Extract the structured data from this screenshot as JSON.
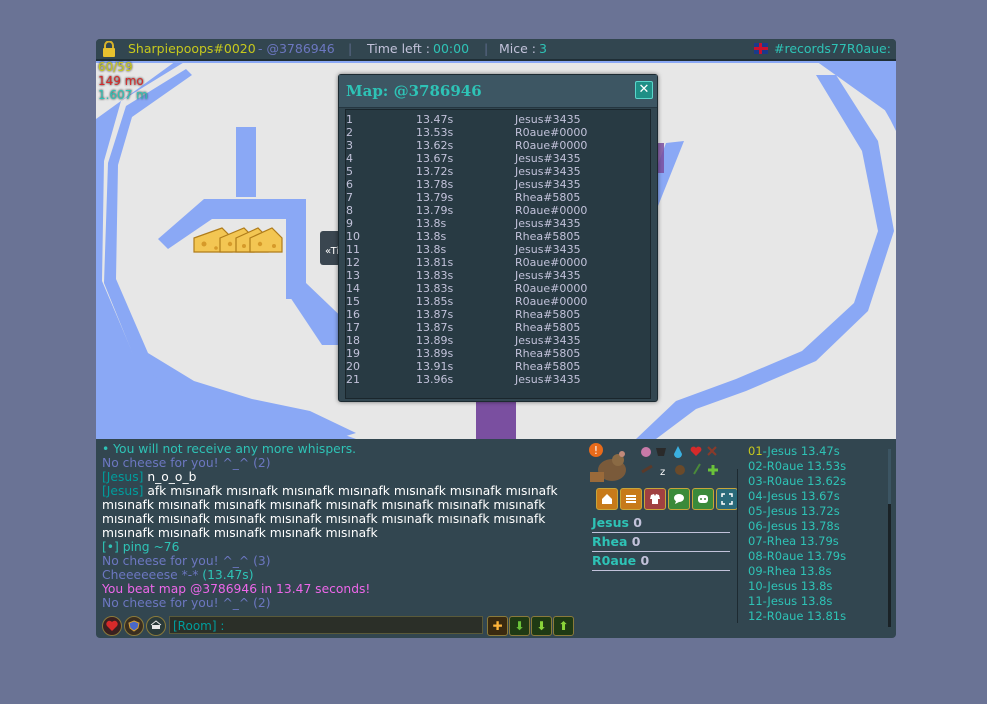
{
  "topbar": {
    "player": "Sharpiepoops#0020",
    "map_code": " - @3786946",
    "time_label": "Time left : ",
    "time_value": "00:00",
    "mice_label": "Mice : ",
    "mice_value": "3",
    "room": "#records77R0aue:",
    "sep1": "|",
    "sep2": "|"
  },
  "stats": {
    "fps": "60/59",
    "mo": "149 mo",
    "m": "1.607 m"
  },
  "map_sign": "«Ti",
  "popup": {
    "title": "Map: @3786946",
    "close_label": "✕",
    "records": [
      {
        "rank": "1",
        "time": "13.47s",
        "player": "Jesus#3435"
      },
      {
        "rank": "2",
        "time": "13.53s",
        "player": "R0aue#0000"
      },
      {
        "rank": "3",
        "time": "13.62s",
        "player": "R0aue#0000"
      },
      {
        "rank": "4",
        "time": "13.67s",
        "player": "Jesus#3435"
      },
      {
        "rank": "5",
        "time": "13.72s",
        "player": "Jesus#3435"
      },
      {
        "rank": "6",
        "time": "13.78s",
        "player": "Jesus#3435"
      },
      {
        "rank": "7",
        "time": "13.79s",
        "player": "Rhea#5805"
      },
      {
        "rank": "8",
        "time": "13.79s",
        "player": "R0aue#0000"
      },
      {
        "rank": "9",
        "time": "13.8s",
        "player": "Jesus#3435"
      },
      {
        "rank": "10",
        "time": "13.8s",
        "player": "Rhea#5805"
      },
      {
        "rank": "11",
        "time": "13.8s",
        "player": "Jesus#3435"
      },
      {
        "rank": "12",
        "time": "13.81s",
        "player": "R0aue#0000"
      },
      {
        "rank": "13",
        "time": "13.83s",
        "player": "Jesus#3435"
      },
      {
        "rank": "14",
        "time": "13.83s",
        "player": "R0aue#0000"
      },
      {
        "rank": "15",
        "time": "13.85s",
        "player": "R0aue#0000"
      },
      {
        "rank": "16",
        "time": "13.87s",
        "player": "Rhea#5805"
      },
      {
        "rank": "17",
        "time": "13.87s",
        "player": "Rhea#5805"
      },
      {
        "rank": "18",
        "time": "13.89s",
        "player": "Jesus#3435"
      },
      {
        "rank": "19",
        "time": "13.89s",
        "player": "Rhea#5805"
      },
      {
        "rank": "20",
        "time": "13.91s",
        "player": "Rhea#5805"
      },
      {
        "rank": "21",
        "time": "13.96s",
        "player": "Jesus#3435"
      }
    ]
  },
  "chat": {
    "lines": [
      {
        "text": "• You will not receive any more whispers.",
        "color": "#2ec3b6"
      },
      {
        "text": "No cheese for you! ^_^ (2)",
        "color": "#6c77c1"
      },
      {
        "prefix": "[Jesus]",
        "text": " n_o_o_b",
        "color": "#ffffff",
        "prefix_color": "#009d9d"
      },
      {
        "prefix": "[Jesus]",
        "text": " afk mısınafk mısınafk mısınafk mısınafk mısınafk mısınafk mısınafk mısınafk mısınafk mısınafk mısınafk mısınafk mısınafk mısınafk mısınafk mısınafk mısınafk mısınafk mısınafk mısınafk mısınafk mısınafk mısınafk mısınafk mısınafk mısınafk mısınafk mısınafk",
        "color": "#ffffff",
        "prefix_color": "#009d9d"
      },
      {
        "text": "[•] ping ~76",
        "color": "#2ec3b6"
      },
      {
        "text": "No cheese for you! ^_^ (3)",
        "color": "#6c77c1"
      },
      {
        "text": "Cheeeeeese *-* (13.47s)",
        "color": "#6c77c1",
        "highlight": "(13.47s)"
      },
      {
        "text": "You beat map @3786946 in 13.47 seconds!",
        "color": "#ed67ea"
      },
      {
        "text": "No cheese for you! ^_^ (2)",
        "color": "#6c77c1"
      }
    ],
    "input_placeholder": "[Room] :"
  },
  "teams": [
    {
      "name": "Jesus",
      "score": "0"
    },
    {
      "name": "Rhea",
      "score": "0"
    },
    {
      "name": "R0aue",
      "score": "0"
    }
  ],
  "ranking": [
    {
      "num": "01",
      "entry": "-Jesus 13.47s"
    },
    {
      "num": "02",
      "entry": "-R0aue 13.53s"
    },
    {
      "num": "03",
      "entry": "-R0aue 13.62s"
    },
    {
      "num": "04",
      "entry": "-Jesus 13.67s"
    },
    {
      "num": "05",
      "entry": "-Jesus 13.72s"
    },
    {
      "num": "06",
      "entry": "-Jesus 13.78s"
    },
    {
      "num": "07",
      "entry": "-Rhea 13.79s"
    },
    {
      "num": "08",
      "entry": "-R0aue 13.79s"
    },
    {
      "num": "09",
      "entry": "-Rhea 13.8s"
    },
    {
      "num": "10",
      "entry": "-Jesus 13.8s"
    },
    {
      "num": "11",
      "entry": "-Jesus 13.8s"
    },
    {
      "num": "12",
      "entry": "-R0aue 13.81s"
    }
  ],
  "colors": {
    "accent": "#2ec3b6",
    "player_name": "#c7c91d",
    "text": "#c2c2da",
    "map_platform": "#8aa8f5",
    "map_bg": "#e7e7e7"
  },
  "icons": {
    "lock": "lock-icon",
    "flag": "uk-flag-icon",
    "cheese": "cheese-icon",
    "close": "close-icon"
  }
}
